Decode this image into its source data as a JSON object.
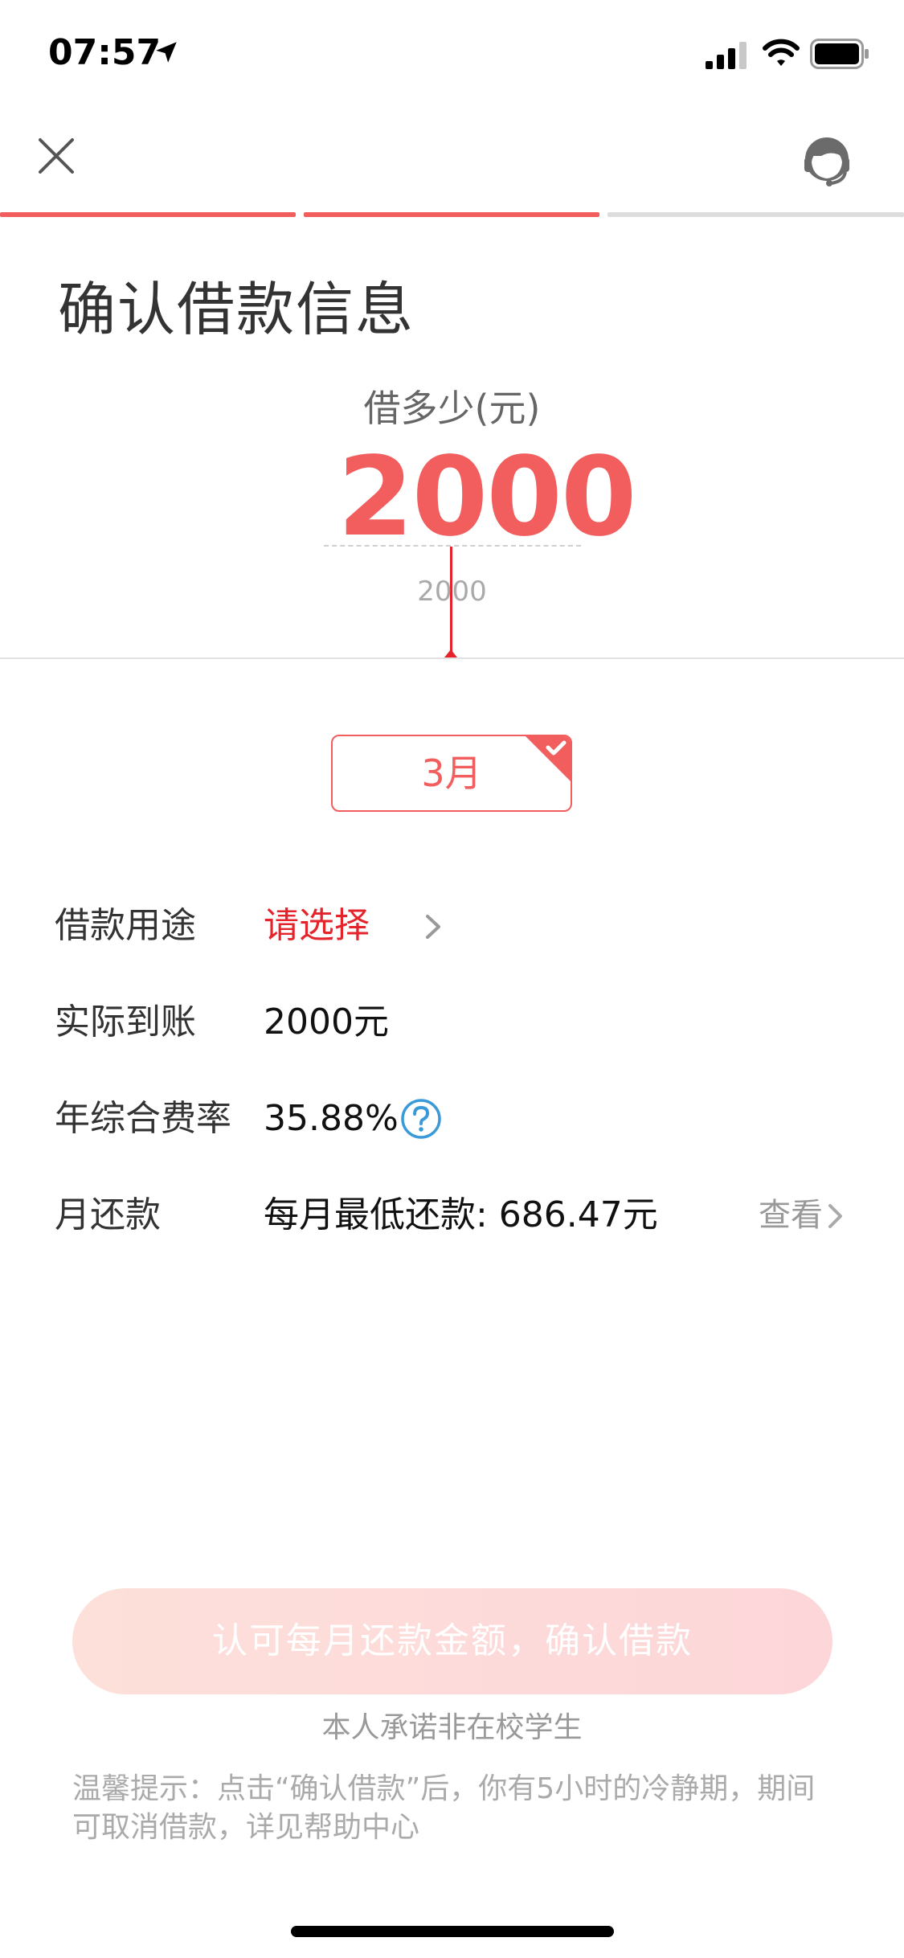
{
  "status_bar": {
    "time": "07:57"
  },
  "header": {
    "title": "确认借款信息"
  },
  "progress": {
    "steps_total": 3,
    "steps_done": 2
  },
  "amount": {
    "label": "借多少(元)",
    "value": "2000",
    "slider_caption": "2000"
  },
  "term": {
    "label": "3月",
    "selected": true
  },
  "rows": {
    "purpose": {
      "label": "借款用途",
      "value": "请选择"
    },
    "actual": {
      "label": "实际到账",
      "value": "2000元"
    },
    "rate": {
      "label": "年综合费率",
      "value": "35.88%"
    },
    "monthly": {
      "label": "月还款",
      "value": "每月最低还款: 686.47元",
      "view_label": "查看"
    }
  },
  "footer": {
    "confirm_label": "认可每月还款金额，确认借款",
    "pledge": "本人承诺非在校学生",
    "tip": "温馨提示：点击“确认借款”后，你有5小时的冷静期，期间可取消借款，详见帮助中心"
  },
  "colors": {
    "accent": "#f25d5d",
    "accent_red_text": "#e5232b",
    "progress_inactive": "#dddddd",
    "button_gradient_start": "#fde0da",
    "button_gradient_end": "#fdd6d9",
    "help_blue": "#3a9ad9"
  },
  "icons": {
    "close": "close-icon",
    "support": "customer-service-icon",
    "location": "location-arrow-icon",
    "signal": "signal-icon",
    "wifi": "wifi-icon",
    "battery": "battery-icon",
    "check": "check-icon",
    "chevron": "chevron-right-icon",
    "help": "help-icon"
  }
}
